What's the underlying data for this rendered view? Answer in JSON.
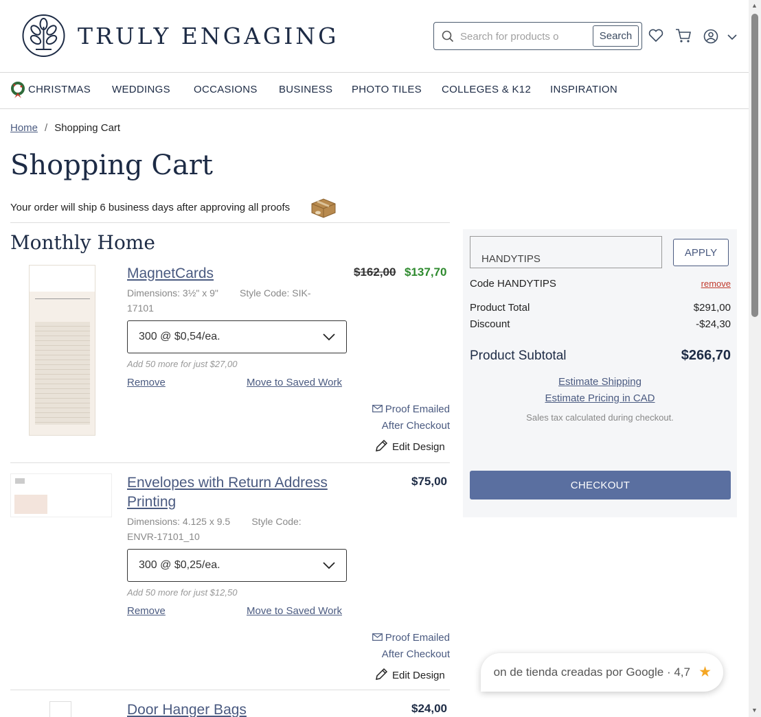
{
  "brand": {
    "name": "TRULY ENGAGING"
  },
  "search": {
    "placeholder": "Search for products o",
    "button_label": "Search"
  },
  "nav": {
    "items": [
      "CHRISTMAS",
      "WEDDINGS",
      "OCCASIONS",
      "BUSINESS",
      "PHOTO TILES",
      "COLLEGES & K12",
      "INSPIRATION"
    ]
  },
  "breadcrumb": {
    "home": "Home",
    "separator": "/",
    "current": "Shopping Cart"
  },
  "page": {
    "title": "Shopping Cart",
    "ship_note": "Your order will ship 6 business days after approving all proofs"
  },
  "group": {
    "title": "Monthly Home"
  },
  "items": [
    {
      "name": "MagnetCards",
      "dimensions": "Dimensions: 3½\" x 9\"",
      "style_code": "Style Code: SIK-17101",
      "qty": "300 @ $0,54/ea.",
      "add_more": "Add 50 more for just $27,00",
      "remove": "Remove",
      "save": "Move to Saved Work",
      "price_original": "$162,00",
      "price_sale": "$137,70",
      "proof_line1": "Proof Emailed",
      "proof_line2": "After Checkout",
      "edit": "Edit Design"
    },
    {
      "name": "Envelopes with Return Address Printing",
      "dimensions": "Dimensions: 4.125 x 9.5",
      "style_code": "Style Code: ENVR-17101_10",
      "qty": "300 @ $0,25/ea.",
      "add_more": "Add 50 more for just $12,50",
      "remove": "Remove",
      "save": "Move to Saved Work",
      "price": "$75,00",
      "proof_line1": "Proof Emailed",
      "proof_line2": "After Checkout",
      "edit": "Edit Design"
    },
    {
      "name": "Door Hanger Bags",
      "price": "$24,00"
    }
  ],
  "summary": {
    "promo_value": "HANDYTIPS",
    "apply_label": "APPLY",
    "code_label": "Code HANDYTIPS",
    "remove_code": "remove",
    "product_total_label": "Product Total",
    "product_total": "$291,00",
    "discount_label": "Discount",
    "discount": "-$24,30",
    "subtotal_label": "Product Subtotal",
    "subtotal": "$266,70",
    "estimate_shipping": "Estimate Shipping",
    "estimate_cad": "Estimate Pricing in CAD",
    "tax_note": "Sales tax calculated during checkout.",
    "checkout_label": "CHECKOUT"
  },
  "google_badge": {
    "text": "on de tienda creadas por Google · 4,7",
    "star": "★"
  },
  "colors": {
    "navy": "#1d2b45",
    "link": "#4a5a80",
    "sale": "#2e8a2e",
    "checkout": "#5a6fa0"
  }
}
